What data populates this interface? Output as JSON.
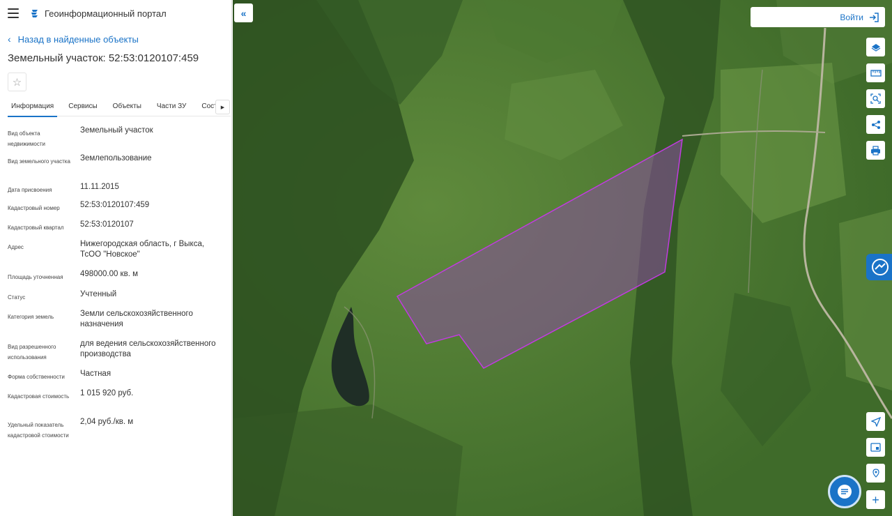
{
  "header": {
    "title": "Геоинформационный портал"
  },
  "nav": {
    "back_label": "Назад в найденные объекты"
  },
  "object": {
    "title": "Земельный участок: 52:53:0120107:459"
  },
  "tabs": [
    {
      "label": "Информация",
      "active": true
    },
    {
      "label": "Сервисы",
      "active": false
    },
    {
      "label": "Объекты",
      "active": false
    },
    {
      "label": "Части ЗУ",
      "active": false
    },
    {
      "label": "Состав",
      "active": false
    }
  ],
  "fields": [
    {
      "label": "Вид объекта недвижимости",
      "value": "Земельный участок"
    },
    {
      "label": "Вид земельного участка",
      "value": "Землепользование"
    },
    {
      "label": "Дата присвоения",
      "value": "11.11.2015"
    },
    {
      "label": "Кадастровый номер",
      "value": "52:53:0120107:459"
    },
    {
      "label": "Кадастровый квартал",
      "value": "52:53:0120107"
    },
    {
      "label": "Адрес",
      "value": "Нижегородская область, г Выкса, ТсОО \"Новское\""
    },
    {
      "label": "Площадь уточненная",
      "value": "498000.00 кв. м"
    },
    {
      "label": "Статус",
      "value": "Учтенный"
    },
    {
      "label": "Категория земель",
      "value": "Земли сельскохозяйственного назначения"
    },
    {
      "label": "Вид разрешенного использования",
      "value": "для ведения сельскохозяйственного производства"
    },
    {
      "label": "Форма собственности",
      "value": "Частная"
    },
    {
      "label": "Кадастровая стоимость",
      "value": "1 015 920 руб."
    },
    {
      "label": "Удельный показатель кадастровой стоимости",
      "value": "2,04 руб./кв. м"
    }
  ],
  "map": {
    "login_label": "Войти"
  },
  "colors": {
    "accent": "#1a73c7",
    "parcel_fill": "#8a4fa0",
    "parcel_stroke": "#c13be0"
  }
}
